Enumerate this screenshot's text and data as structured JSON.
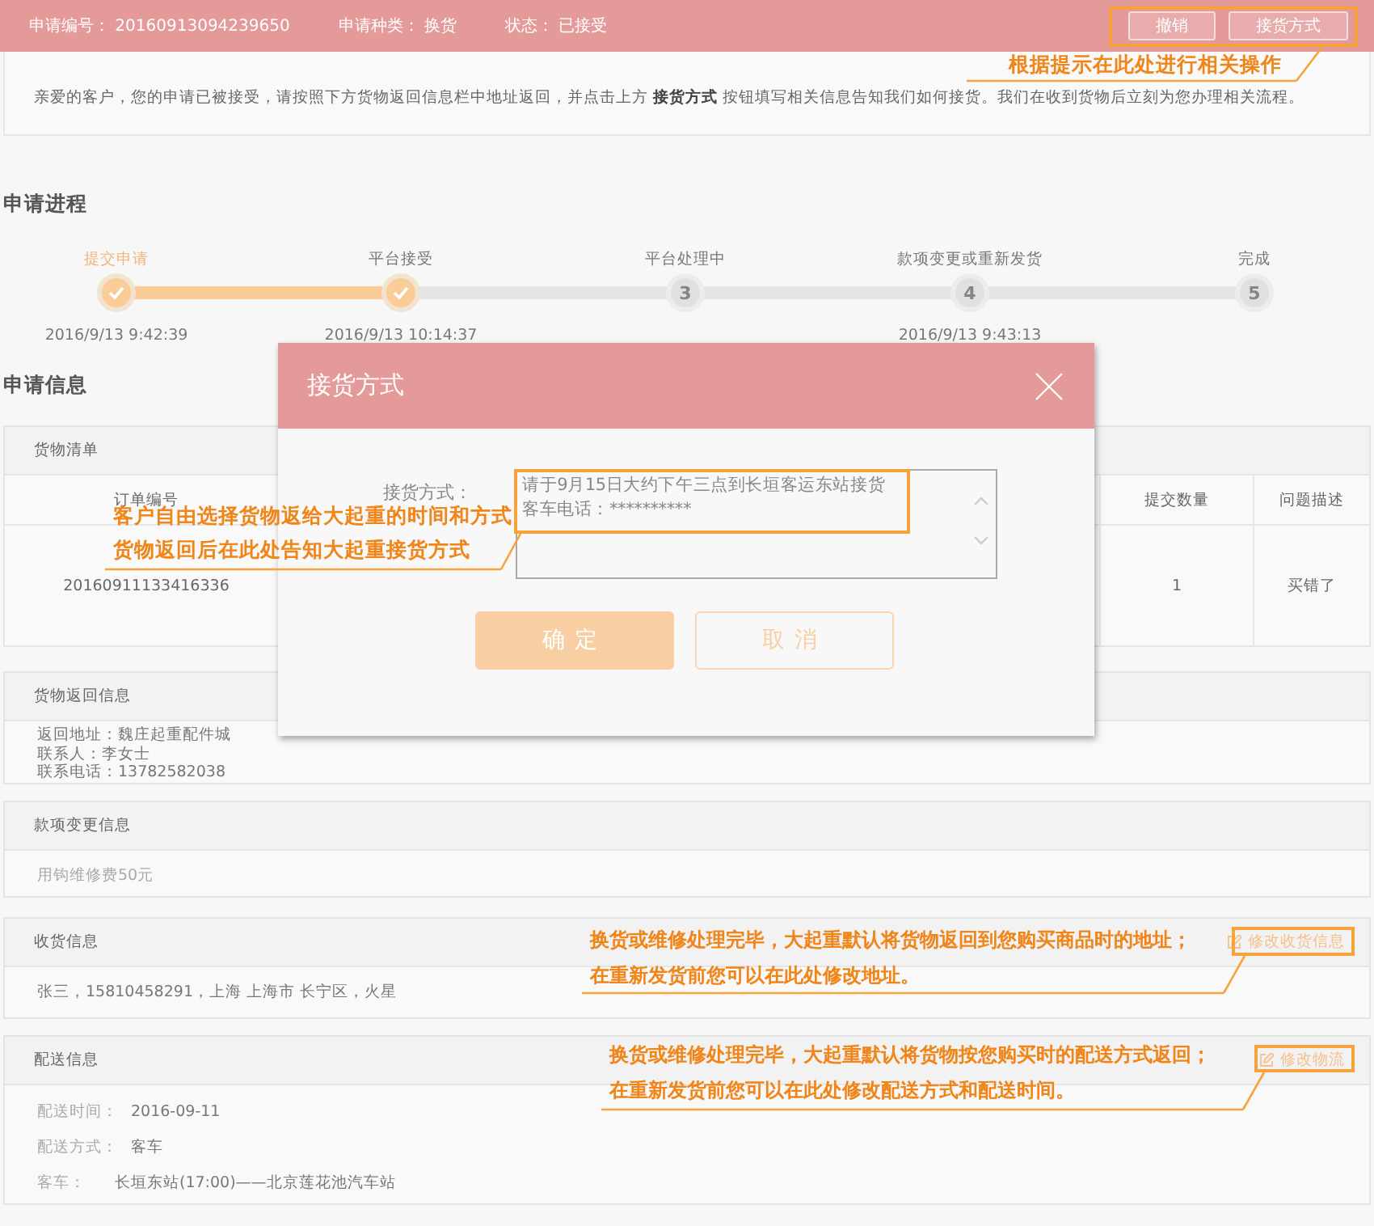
{
  "header": {
    "fields": [
      {
        "label": "申请编号：",
        "value": "20160913094239650"
      },
      {
        "label": "申请种类：",
        "value": "换货"
      },
      {
        "label": "状态：",
        "value": "已接受"
      }
    ],
    "buttons": [
      {
        "label": "撤销"
      },
      {
        "label": "接货方式"
      }
    ]
  },
  "notice": {
    "text": "亲爱的客户，您的申请已被接受，请按照下方货物返回信息栏中地址返回，并点击上方 **接货方式** 按钮填写相关信息告知我们如何接货。我们在收到货物后立刻为您办理相关流程。"
  },
  "progress": {
    "title": "申请进程",
    "steps": [
      {
        "label": "提交申请",
        "done": true,
        "current": true,
        "time": "2016/9/13 9:42:39"
      },
      {
        "label": "平台接受",
        "done": true,
        "current": false,
        "time": "2016/9/13 10:14:37"
      },
      {
        "label": "平台处理中",
        "done": false,
        "current": false,
        "number": "3"
      },
      {
        "label": "款项变更或重新发货",
        "done": false,
        "current": false,
        "number": "4",
        "time": "2016/9/13 9:43:13"
      },
      {
        "label": "完成",
        "done": false,
        "current": false,
        "number": "5"
      }
    ]
  },
  "info_title": "申请信息",
  "goods": {
    "title": "货物清单",
    "columns": [
      "订单编号",
      "提交数量",
      "问题描述"
    ],
    "rows": [
      [
        "20160911133416336",
        "1",
        "买错了"
      ]
    ]
  },
  "return_info": {
    "title": "货物返回信息",
    "lines": [
      "返回地址：魏庄起重配件城",
      "联系人：李女士",
      "联系电话：13782582038"
    ]
  },
  "payment_change": {
    "title": "款项变更信息",
    "text": "用钩维修费50元"
  },
  "receiving": {
    "title": "收货信息",
    "button": "修改收货信息",
    "text": "张三，15810458291，上海 上海市 长宁区，火星"
  },
  "delivery": {
    "title": "配送信息",
    "button": "修改物流",
    "rows": [
      {
        "label": "配送时间：",
        "value": "2016-09-11"
      },
      {
        "label": "配送方式：",
        "value": "客车"
      },
      {
        "label": "客车：",
        "value": "长垣东站(17:00)——北京莲花池汽车站"
      }
    ]
  },
  "dialog": {
    "title": "接货方式",
    "field_label": "接货方式：",
    "field_lines": [
      "请于9月15日大约下午三点到长垣客运东站接货",
      "客车电话：**********"
    ],
    "buttons": [
      {
        "label": "确定",
        "primary": true
      },
      {
        "label": "取消",
        "primary": false
      }
    ]
  },
  "annotations": [
    {
      "lines": [
        "根据提示在此处进行相关操作"
      ]
    },
    {
      "lines": [
        "客户自由选择货物返给大起重的时间和方式",
        "货物返回后在此处告知大起重接货方式"
      ]
    },
    {
      "lines": [
        "换货或维修处理完毕，大起重默认将货物返回到您购买商品时的地址；",
        "在重新发货前您可以在此处修改地址。"
      ]
    },
    {
      "lines": [
        "换货或维修处理完毕，大起重默认将货物按您购买时的配送方式返回；",
        "在重新发货前您可以在此处修改配送方式和配送时间。"
      ]
    }
  ]
}
